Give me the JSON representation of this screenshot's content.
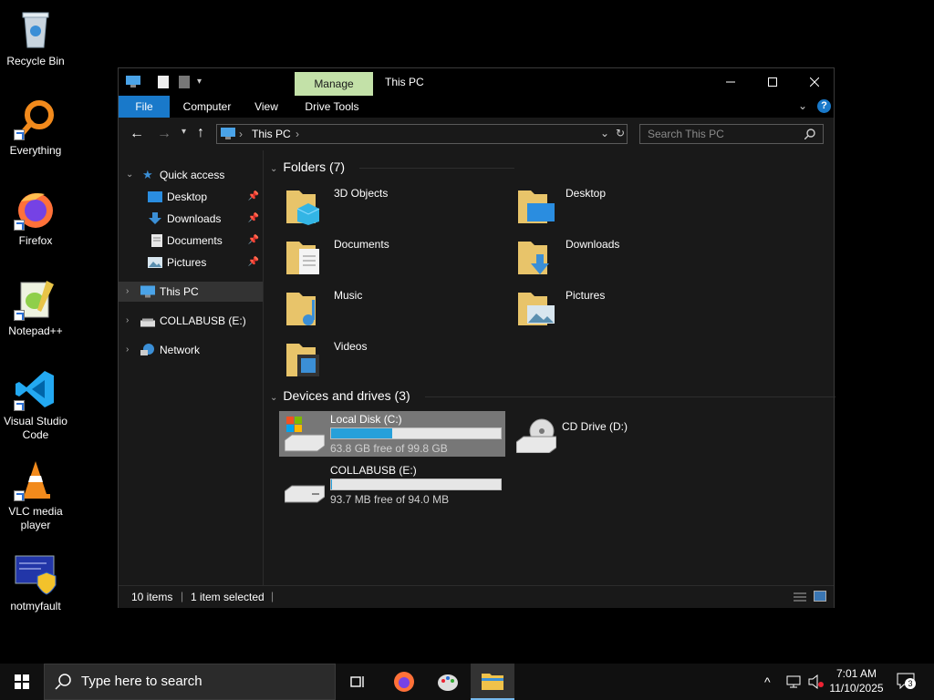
{
  "desktop": {
    "icons": [
      {
        "label": "Recycle Bin"
      },
      {
        "label": "Everything"
      },
      {
        "label": "Firefox"
      },
      {
        "label": "Notepad++"
      },
      {
        "label": "Visual Studio Code"
      },
      {
        "label": "VLC media player"
      },
      {
        "label": "notmyfault"
      }
    ]
  },
  "window": {
    "title": "This PC",
    "manage_tab": "Manage",
    "tabs": {
      "file": "File",
      "computer": "Computer",
      "view": "View",
      "drive_tools": "Drive Tools"
    },
    "address": {
      "location": "This PC"
    },
    "search_placeholder": "Search This PC"
  },
  "navpane": {
    "quick_access": "Quick access",
    "items": [
      {
        "label": "Desktop"
      },
      {
        "label": "Downloads"
      },
      {
        "label": "Documents"
      },
      {
        "label": "Pictures"
      }
    ],
    "this_pc": "This PC",
    "usb": "COLLABUSB (E:)",
    "network": "Network"
  },
  "content": {
    "folders_header": "Folders (7)",
    "folders": [
      {
        "name": "3D Objects"
      },
      {
        "name": "Desktop"
      },
      {
        "name": "Documents"
      },
      {
        "name": "Downloads"
      },
      {
        "name": "Music"
      },
      {
        "name": "Pictures"
      },
      {
        "name": "Videos"
      }
    ],
    "drives_header": "Devices and drives (3)",
    "drives": [
      {
        "name": "Local Disk (C:)",
        "free_text": "63.8 GB free of 99.8 GB",
        "used_fraction": 0.36
      },
      {
        "name": "CD Drive (D:)"
      },
      {
        "name": "COLLABUSB (E:)",
        "free_text": "93.7 MB free of 94.0 MB",
        "used_fraction": 0.003
      }
    ]
  },
  "status": {
    "items": "10 items",
    "selected": "1 item selected"
  },
  "taskbar": {
    "search_placeholder": "Type here to search",
    "time": "7:01 AM",
    "date": "11/10/2025",
    "notification_count": "3"
  },
  "colors": {
    "accent": "#1979ca",
    "manage_tab": "#c3e1a8",
    "disk_bar": "#26a0da"
  }
}
